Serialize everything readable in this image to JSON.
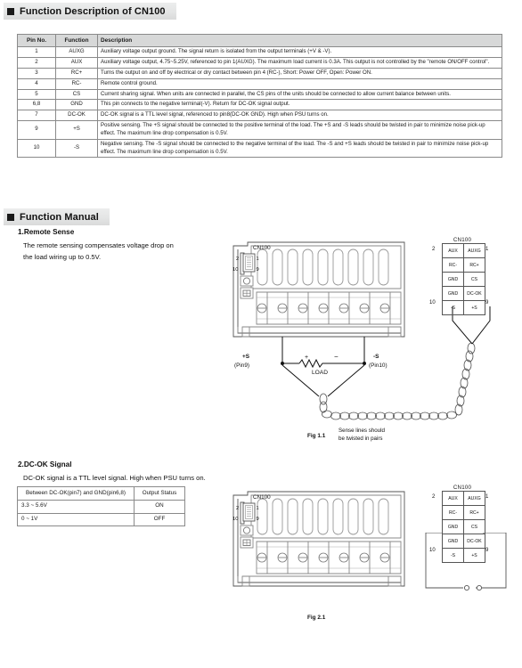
{
  "sections": {
    "function_description": "Function Description of CN100",
    "function_manual": "Function Manual"
  },
  "pin_table": {
    "headers": [
      "Pin No.",
      "Function",
      "Description"
    ],
    "rows": [
      {
        "pin": "1",
        "function": "AUXG",
        "description": "Auxiliary voltage output ground. The signal return is isolated from the output terminals (+V & -V)."
      },
      {
        "pin": "2",
        "function": "AUX",
        "description": "Auxiliary voltage output, 4.75~5.25V, referenced to pin 1(AUXG). The maximum load current is 0.3A. This output is not controlled by the \"remote ON/OFF control\"."
      },
      {
        "pin": "3",
        "function": "RC+",
        "description": "Turns the output on and off by electrical or dry contact between pin 4 (RC-), Short: Power OFF, Open: Power ON."
      },
      {
        "pin": "4",
        "function": "RC-",
        "description": "Remote control ground."
      },
      {
        "pin": "5",
        "function": "CS",
        "description": "Current sharing signal. When units are connected in parallel, the CS pins of the units should be connected to allow current balance between units."
      },
      {
        "pin": "6,8",
        "function": "GND",
        "description": "This pin connects to the negative terminal(-V). Return for DC-OK signal output."
      },
      {
        "pin": "7",
        "function": "DC-OK",
        "description": "DC-OK signal is a TTL level signal, referenced to pin8(DC-OK GND). High when PSU turns on."
      },
      {
        "pin": "9",
        "function": "+S",
        "description": "Positive sensing. The +S signal should be connected to the positive terminal of the load. The +S and -S leads should be twisted in pair to minimize noise pick-up effect. The maximum line drop compensation is 0.5V."
      },
      {
        "pin": "10",
        "function": "-S",
        "description": "Negative sensing. The -S signal should be connected to the negative terminal of the load. The -S and +S leads should be twisted in pair to minimize noise pick-up effect. The maximum line drop compensation is 0.5V."
      }
    ]
  },
  "remote_sense": {
    "heading": "1.Remote Sense",
    "body_line1": "The remote sensing compensates voltage drop on",
    "body_line2": "the load wiring up to 0.5V.",
    "fig_caption": "Fig 1.1",
    "psu_connector_label": "CN100",
    "psu_pin_top_left": "2",
    "psu_pin_top_right": "1",
    "psu_pin_bottom_left": "10",
    "psu_pin_bottom_right": "9",
    "plus_s_label": "+S",
    "plus_s_pin": "(Pin9)",
    "minus_s_label": "-S",
    "minus_s_pin": "(Pin10)",
    "load_label": "LOAD",
    "load_plus": "+",
    "load_minus": "−",
    "twist_note_line1": "Sense lines should",
    "twist_note_line2": "be twisted in pairs",
    "cn100": {
      "title": "CN100",
      "left_top_num": "2",
      "right_top_num": "1",
      "left_bottom_num": "10",
      "right_bottom_num": "9",
      "grid": [
        [
          "AUX",
          "AUXG"
        ],
        [
          "RC-",
          "RC+"
        ],
        [
          "GND",
          "CS"
        ],
        [
          "GND",
          "DC-OK"
        ],
        [
          "-S",
          "+S"
        ]
      ]
    }
  },
  "dcok": {
    "heading": "2.DC-OK Signal",
    "body": "DC-OK signal is a TTL level signal. High when PSU turns on.",
    "table": {
      "headers": [
        "Between DC-OK(pin7) and GND(pin6,8)",
        "Output Status"
      ],
      "rows": [
        {
          "range": "3.3 ~ 5.6V",
          "status": "ON"
        },
        {
          "range": "0 ~ 1V",
          "status": "OFF"
        }
      ]
    },
    "fig_caption": "Fig 2.1",
    "psu_connector_label": "CN100",
    "psu_pin_top_left": "2",
    "psu_pin_top_right": "1",
    "psu_pin_bottom_left": "10",
    "psu_pin_bottom_right": "9",
    "cn100": {
      "title": "CN100",
      "left_top_num": "2",
      "right_top_num": "1",
      "left_bottom_num": "10",
      "right_bottom_num": "9",
      "grid": [
        [
          "AUX",
          "AUXG"
        ],
        [
          "RC-",
          "RC+"
        ],
        [
          "GND",
          "CS"
        ],
        [
          "GND",
          "DC-OK"
        ],
        [
          "-S",
          "+S"
        ]
      ]
    }
  },
  "colors": {
    "header_bar": "#e4e5e5",
    "table_header": "#d7d8d8",
    "line": "#555555",
    "text": "#1a1a1a"
  }
}
